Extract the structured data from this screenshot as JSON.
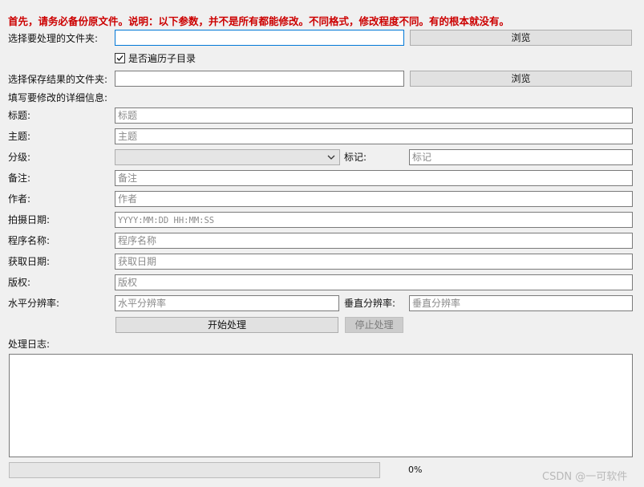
{
  "notice": "首先，请务必备份原文件。说明：以下参数，并不是所有都能修改。不同格式，修改程度不同。有的根本就没有。",
  "source_folder": {
    "label": "选择要处理的文件夹:",
    "value": "",
    "browse_label": "浏览"
  },
  "recursive": {
    "label": "是否遍历子目录",
    "checked": true
  },
  "output_folder": {
    "label": "选择保存结果的文件夹:",
    "value": "",
    "browse_label": "浏览"
  },
  "details_heading": "填写要修改的详细信息:",
  "fields": {
    "title": {
      "label": "标题:",
      "placeholder": "标题"
    },
    "subject": {
      "label": "主题:",
      "placeholder": "主题"
    },
    "rating": {
      "label": "分级:",
      "value": ""
    },
    "tags": {
      "label": "标记:",
      "placeholder": "标记"
    },
    "comments": {
      "label": "备注:",
      "placeholder": "备注"
    },
    "author": {
      "label": "作者:",
      "placeholder": "作者"
    },
    "date_taken": {
      "label": "拍摄日期:",
      "placeholder": "YYYY:MM:DD HH:MM:SS"
    },
    "program_name": {
      "label": "程序名称:",
      "placeholder": "程序名称"
    },
    "date_acquired": {
      "label": "获取日期:",
      "placeholder": "获取日期"
    },
    "copyright": {
      "label": "版权:",
      "placeholder": "版权"
    },
    "h_resolution": {
      "label": "水平分辨率:",
      "placeholder": "水平分辨率"
    },
    "v_resolution": {
      "label": "垂直分辨率:",
      "placeholder": "垂直分辨率"
    }
  },
  "actions": {
    "start_label": "开始处理",
    "stop_label": "停止处理"
  },
  "log": {
    "label": "处理日志:",
    "content": ""
  },
  "progress": {
    "fraction": 0,
    "text": "0%"
  },
  "watermark": "CSDN @一可软件",
  "colors": {
    "notice": "#cc0000",
    "focus_border": "#0078d7",
    "progress_fill": "#06b025"
  }
}
